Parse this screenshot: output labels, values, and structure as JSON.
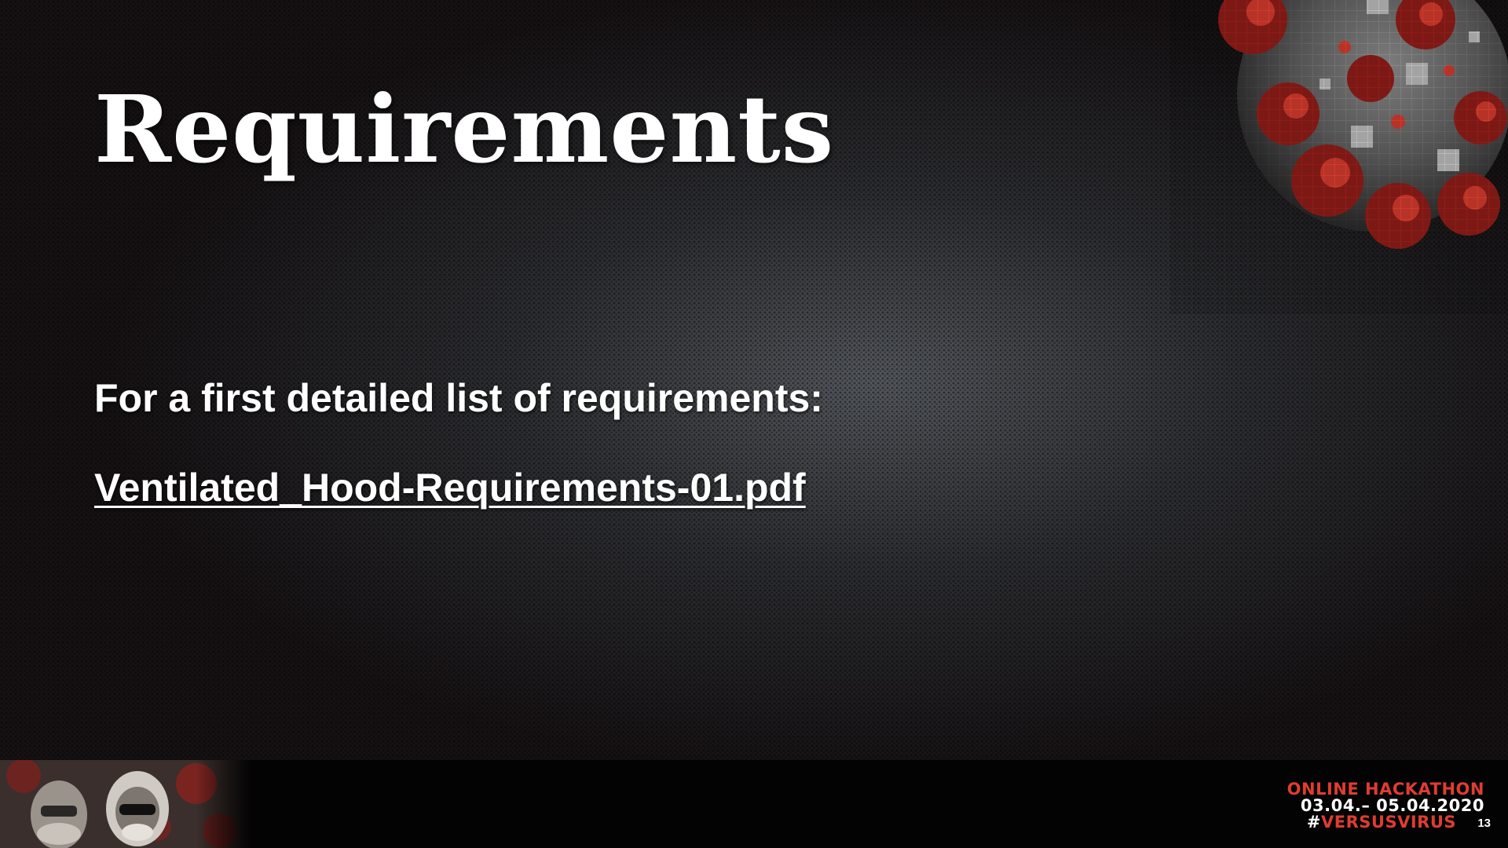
{
  "slide": {
    "title": "Requirements",
    "lead_text": "For a first detailed list of requirements:",
    "link_text": "Ventilated_Hood-Requirements-01.pdf"
  },
  "footer": {
    "event_name": "ONLINE HACKATHON",
    "event_dates": "03.04.– 05.04.2020",
    "hashtag_symbol": "#",
    "hashtag_text": "VERSUSVIRUS",
    "page_number": "13"
  },
  "colors": {
    "accent_red": "#e03c31",
    "text_white": "#ffffff",
    "footer_bg": "#030303"
  },
  "icons": {
    "corner_decoration": "coronavirus-illustration",
    "footer_photo": "masked-people-photo"
  }
}
